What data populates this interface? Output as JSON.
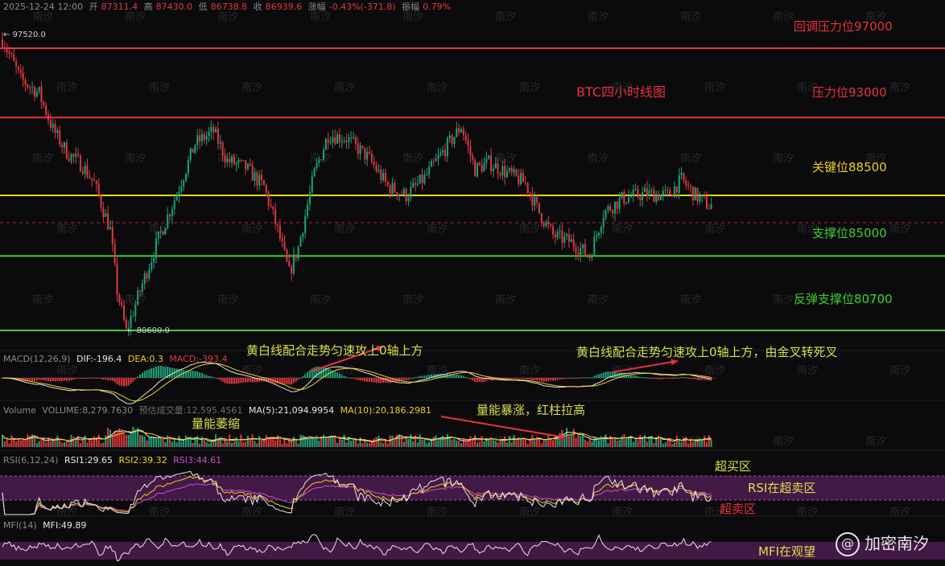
{
  "header": {
    "datetime": "2025-12-24 12:00",
    "open_label": "开",
    "open": "87311.4",
    "high_label": "高",
    "high": "87430.0",
    "low_label": "低",
    "low": "86738.8",
    "close_label": "收",
    "close": "86939.6",
    "change_label": "涨幅",
    "change": "-0.43%(-371.8)",
    "amp_label": "振幅",
    "amp": "0.79%"
  },
  "price_marks": {
    "high_mark": "97520.0",
    "low_mark": "80600.0"
  },
  "levels": [
    {
      "label": "回调压力位97000",
      "price": 97000,
      "color": "#e8323a"
    },
    {
      "label": "压力位93000",
      "price": 93000,
      "color": "#e8323a"
    },
    {
      "label": "关键位88500",
      "price": 88500,
      "color": "#f0d020"
    },
    {
      "label": "支撑位85000",
      "price": 85000,
      "color": "#3fcf2f"
    },
    {
      "label": "反弹支撑位80700",
      "price": 80700,
      "color": "#3fcf2f"
    }
  ],
  "chart_title": "BTC四小时线图",
  "macd": {
    "name": "MACD(12,26,9)",
    "dif": "DIF:-196.4",
    "dea": "DEA:0.3",
    "macd": "MACD:-393.4",
    "note1": "黄白线配合走势匀速攻上0轴上方",
    "note2": "黄白线配合走势匀速攻上0轴上方，由金叉转死叉"
  },
  "volume": {
    "name": "Volume",
    "vol": "VOLUME:8,279.7630",
    "est": "预估成交量:12,595.4561",
    "ma5": "MA(5):21,094.9954",
    "ma10": "MA(10):20,186.2981",
    "note_shrink": "量能萎缩",
    "note_surge": "量能暴涨，红柱拉高"
  },
  "rsi": {
    "name": "RSI(6,12,24)",
    "rsi1": "RSI1:29.65",
    "rsi2": "RSI2:39.32",
    "rsi3": "RSI3:44.61",
    "overbought": "超买区",
    "zone": "RSI在超卖区",
    "oversold": "超卖区"
  },
  "mfi": {
    "name": "MFI(14)",
    "value": "MFI:49.89",
    "note": "MFI在观望"
  },
  "watermark": "加密南汐",
  "grid_mark": "南汐",
  "colors": {
    "up": "#1fa37a",
    "down": "#e0393e",
    "bg": "#0b0b0d",
    "macd_note": "#d8e04a",
    "rsi_band": "#5b1f5e"
  },
  "chart_data": {
    "type": "candlestick",
    "title": "BTC四小时线图",
    "ylim": [
      80000,
      98500
    ],
    "anchors": [
      [
        0,
        97520
      ],
      [
        8,
        95200
      ],
      [
        16,
        94400
      ],
      [
        22,
        92300
      ],
      [
        28,
        91000
      ],
      [
        35,
        90200
      ],
      [
        40,
        89200
      ],
      [
        47,
        86500
      ],
      [
        50,
        83000
      ],
      [
        54,
        80600
      ],
      [
        60,
        83000
      ],
      [
        68,
        86000
      ],
      [
        76,
        88600
      ],
      [
        84,
        91500
      ],
      [
        92,
        92200
      ],
      [
        98,
        90500
      ],
      [
        106,
        90100
      ],
      [
        114,
        89000
      ],
      [
        120,
        86500
      ],
      [
        125,
        84000
      ],
      [
        129,
        85500
      ],
      [
        136,
        89800
      ],
      [
        142,
        92000
      ],
      [
        150,
        91800
      ],
      [
        160,
        90600
      ],
      [
        168,
        89000
      ],
      [
        176,
        88500
      ],
      [
        184,
        89500
      ],
      [
        192,
        91000
      ],
      [
        200,
        92500
      ],
      [
        206,
        90000
      ],
      [
        212,
        90400
      ],
      [
        220,
        89800
      ],
      [
        228,
        89200
      ],
      [
        234,
        87500
      ],
      [
        240,
        86200
      ],
      [
        248,
        85800
      ],
      [
        256,
        85000
      ],
      [
        262,
        87500
      ],
      [
        270,
        88300
      ],
      [
        280,
        88600
      ],
      [
        290,
        88500
      ],
      [
        296,
        89400
      ],
      [
        302,
        88500
      ],
      [
        308,
        87900
      ]
    ]
  }
}
